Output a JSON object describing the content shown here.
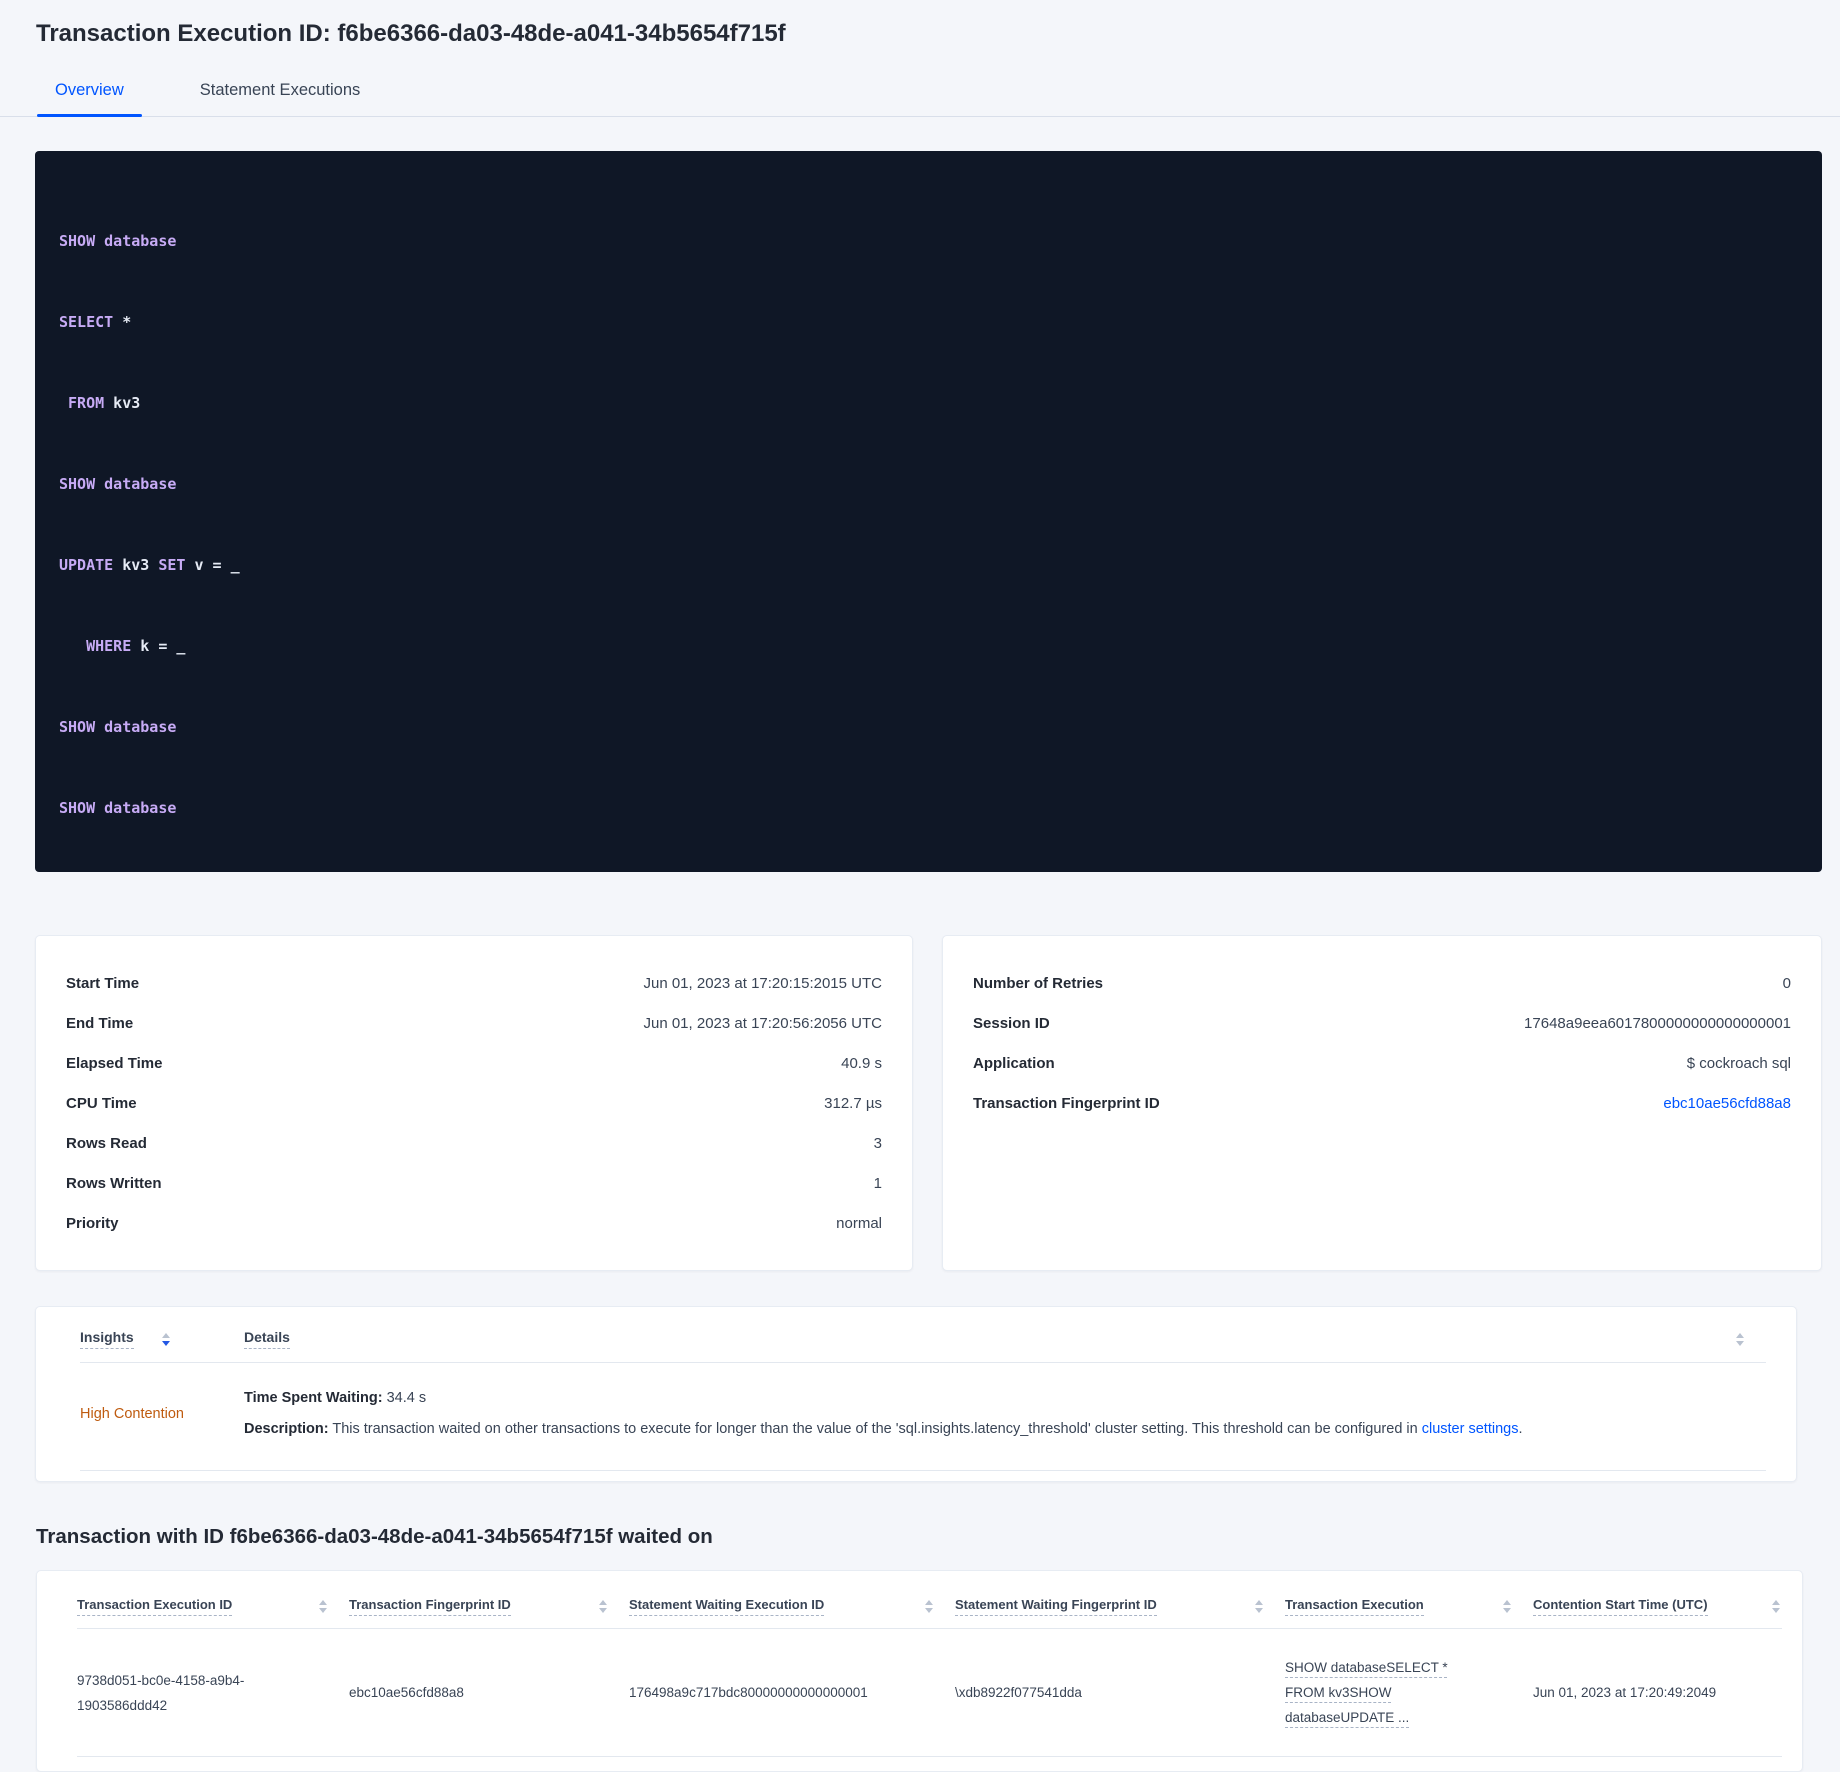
{
  "header": {
    "title": "Transaction Execution ID: f6be6366-da03-48de-a041-34b5654f715f"
  },
  "tabs": {
    "overview": "Overview",
    "statement_executions": "Statement Executions"
  },
  "colors": {
    "accent_blue": "#0055ff",
    "insight_warning_orange": "#bf5b0f",
    "code_background": "#0f1726",
    "code_keyword_lavender": "#c7abf5"
  },
  "sql": {
    "lines": [
      {
        "t0": "SHOW",
        "t1": " database"
      },
      {
        "t0": "SELECT",
        "t1": " *"
      },
      {
        "t0": " FROM",
        "t1": " kv3"
      },
      {
        "t0": "SHOW",
        "t1": " database"
      },
      {
        "t0": "UPDATE",
        "t1": " kv3",
        "t2": " SET",
        "t3": " v = _"
      },
      {
        "t0": "   WHERE",
        "t1": " k = _"
      },
      {
        "t0": "SHOW",
        "t1": " database"
      },
      {
        "t0": "SHOW",
        "t1": " database"
      }
    ]
  },
  "summary_left": {
    "rows": [
      {
        "label": "Start Time",
        "value": "Jun 01, 2023 at 17:20:15:2015 UTC"
      },
      {
        "label": "End Time",
        "value": "Jun 01, 2023 at 17:20:56:2056 UTC"
      },
      {
        "label": "Elapsed Time",
        "value": "40.9 s"
      },
      {
        "label": "CPU Time",
        "value": "312.7 µs"
      },
      {
        "label": "Rows Read",
        "value": "3"
      },
      {
        "label": "Rows Written",
        "value": "1"
      },
      {
        "label": "Priority",
        "value": "normal"
      }
    ]
  },
  "summary_right": {
    "rows": [
      {
        "label": "Number of Retries",
        "value": "0"
      },
      {
        "label": "Session ID",
        "value": "17648a9eea6017800000000000000001"
      },
      {
        "label": "Application",
        "value": "$ cockroach sql"
      },
      {
        "label": "Transaction Fingerprint ID",
        "value": "ebc10ae56cfd88a8"
      }
    ]
  },
  "insights": {
    "col_insights": "Insights",
    "col_details": "Details",
    "row": {
      "insight": "High Contention",
      "waiting_label": "Time Spent Waiting:",
      "waiting_value": " 34.4 s",
      "desc_label": "Description:",
      "desc_text": " This transaction waited on other transactions to execute for longer than the value of the 'sql.insights.latency_threshold' cluster setting. This threshold can be configured in ",
      "desc_link": "cluster settings",
      "desc_period": "."
    }
  },
  "waited": {
    "heading": "Transaction with ID f6be6366-da03-48de-a041-34b5654f715f waited on",
    "columns": [
      "Transaction Execution ID",
      "Transaction Fingerprint ID",
      "Statement Waiting Execution ID",
      "Statement Waiting Fingerprint ID",
      "Transaction Execution",
      "Contention Start Time (UTC)"
    ],
    "row": {
      "exec_id": "9738d051-bc0e-4158-a9b4-1903586ddd42",
      "fingerprint": "ebc10ae56cfd88a8",
      "stmt_exec_id": "176498a9c717bdc80000000000000001",
      "stmt_fingerprint": "\\xdb8922f077541dda",
      "txn_exec": "SHOW databaseSELECT * FROM kv3SHOW databaseUPDATE ...",
      "start_time": "Jun 01, 2023 at 17:20:49:2049"
    }
  }
}
